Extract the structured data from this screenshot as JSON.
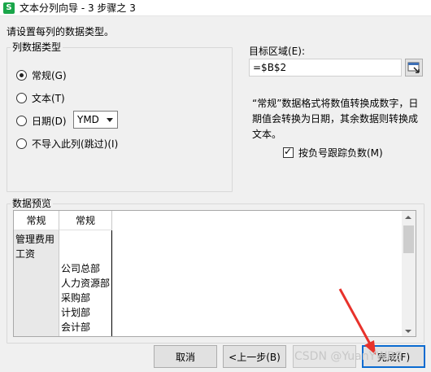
{
  "window": {
    "title": "文本分列向导 - 3 步骤之 3",
    "app_icon_letter": "S"
  },
  "instruction": "请设置每列的数据类型。",
  "column_type": {
    "legend": "列数据类型",
    "options": [
      "常规(G)",
      "文本(T)",
      "日期(D)",
      "不导入此列(跳过)(I)"
    ],
    "selected_index": 0,
    "date_format": "YMD"
  },
  "destination": {
    "label": "目标区域(E):",
    "value": "=$B$2"
  },
  "description": "“常规”数据格式将数值转换成数字，日期值会转换为日期，其余数据则转换成文本。",
  "negative_checkbox": {
    "label": "按负号跟踪负数(M)",
    "checked": true
  },
  "preview": {
    "legend": "数据预览",
    "headers": [
      "常规",
      "常规"
    ],
    "col1": [
      "管理费用",
      "工资"
    ],
    "col2": [
      "公司总部",
      "人力资源部",
      "采购部",
      "计划部",
      "会计部"
    ]
  },
  "buttons": {
    "cancel": "取消",
    "back": "<上一步(B)",
    "next": "",
    "finish": "完成(F)"
  },
  "watermark": "CSDN @YuanYWRS",
  "colors": {
    "default_button_border": "#0a6bd1",
    "arrow": "#e8322b",
    "icon_green": "#1aa64a"
  }
}
